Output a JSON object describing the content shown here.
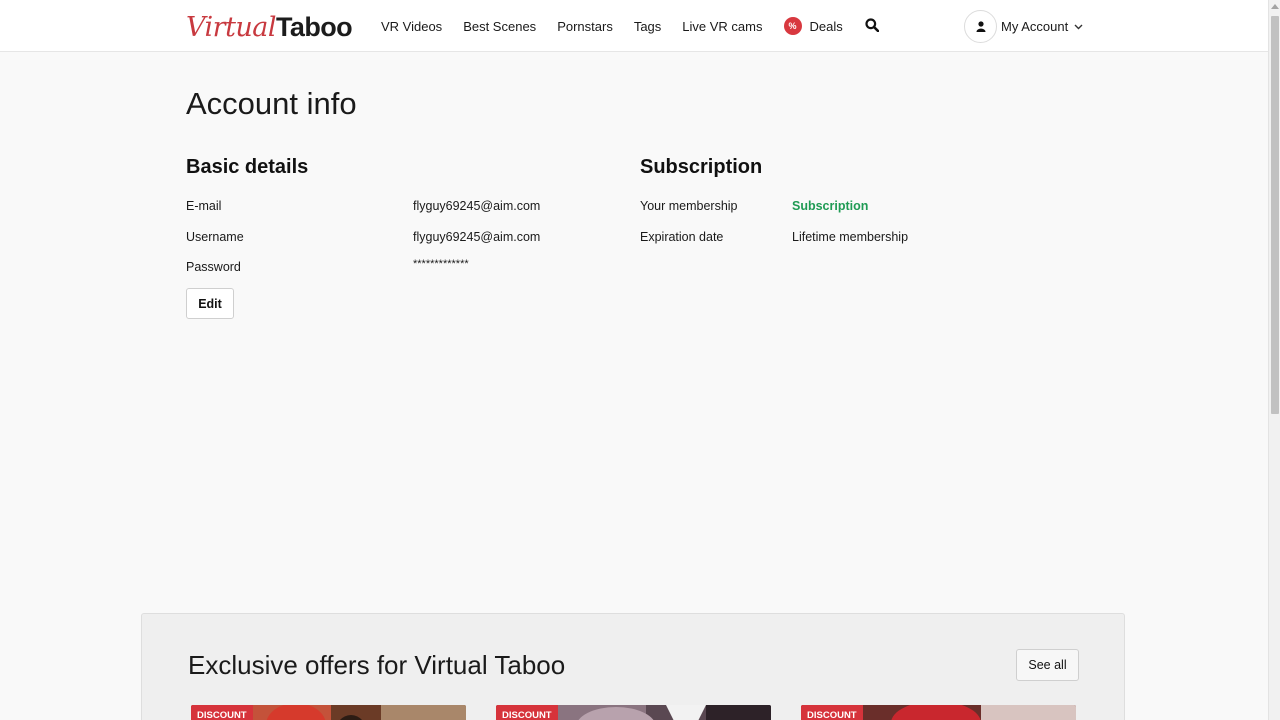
{
  "header": {
    "logo_part1": "Virtual",
    "logo_part2": "Taboo",
    "nav": [
      "VR Videos",
      "Best Scenes",
      "Pornstars",
      "Tags",
      "Live VR cams"
    ],
    "deals_badge": "%",
    "deals_label": "Deals",
    "account_label": "My Account"
  },
  "main": {
    "page_title": "Account info",
    "basic": {
      "title": "Basic details",
      "rows": [
        {
          "label": "E-mail",
          "value": "flyguy69245@aim.com"
        },
        {
          "label": "Username",
          "value": "flyguy69245@aim.com"
        },
        {
          "label": "Password",
          "value": "*************"
        }
      ],
      "edit_label": "Edit"
    },
    "subscription": {
      "title": "Subscription",
      "rows": [
        {
          "label": "Your membership",
          "value": "Subscription"
        },
        {
          "label": "Expiration date",
          "value": "Lifetime membership"
        }
      ]
    }
  },
  "offers": {
    "title": "Exclusive offers for Virtual Taboo",
    "see_all": "See all",
    "cards": [
      {
        "tag": "DISCOUNT"
      },
      {
        "tag": "DISCOUNT"
      },
      {
        "tag": "DISCOUNT"
      }
    ]
  },
  "colors": {
    "brand_red": "#c8393f",
    "membership_green": "#1f9b54"
  }
}
